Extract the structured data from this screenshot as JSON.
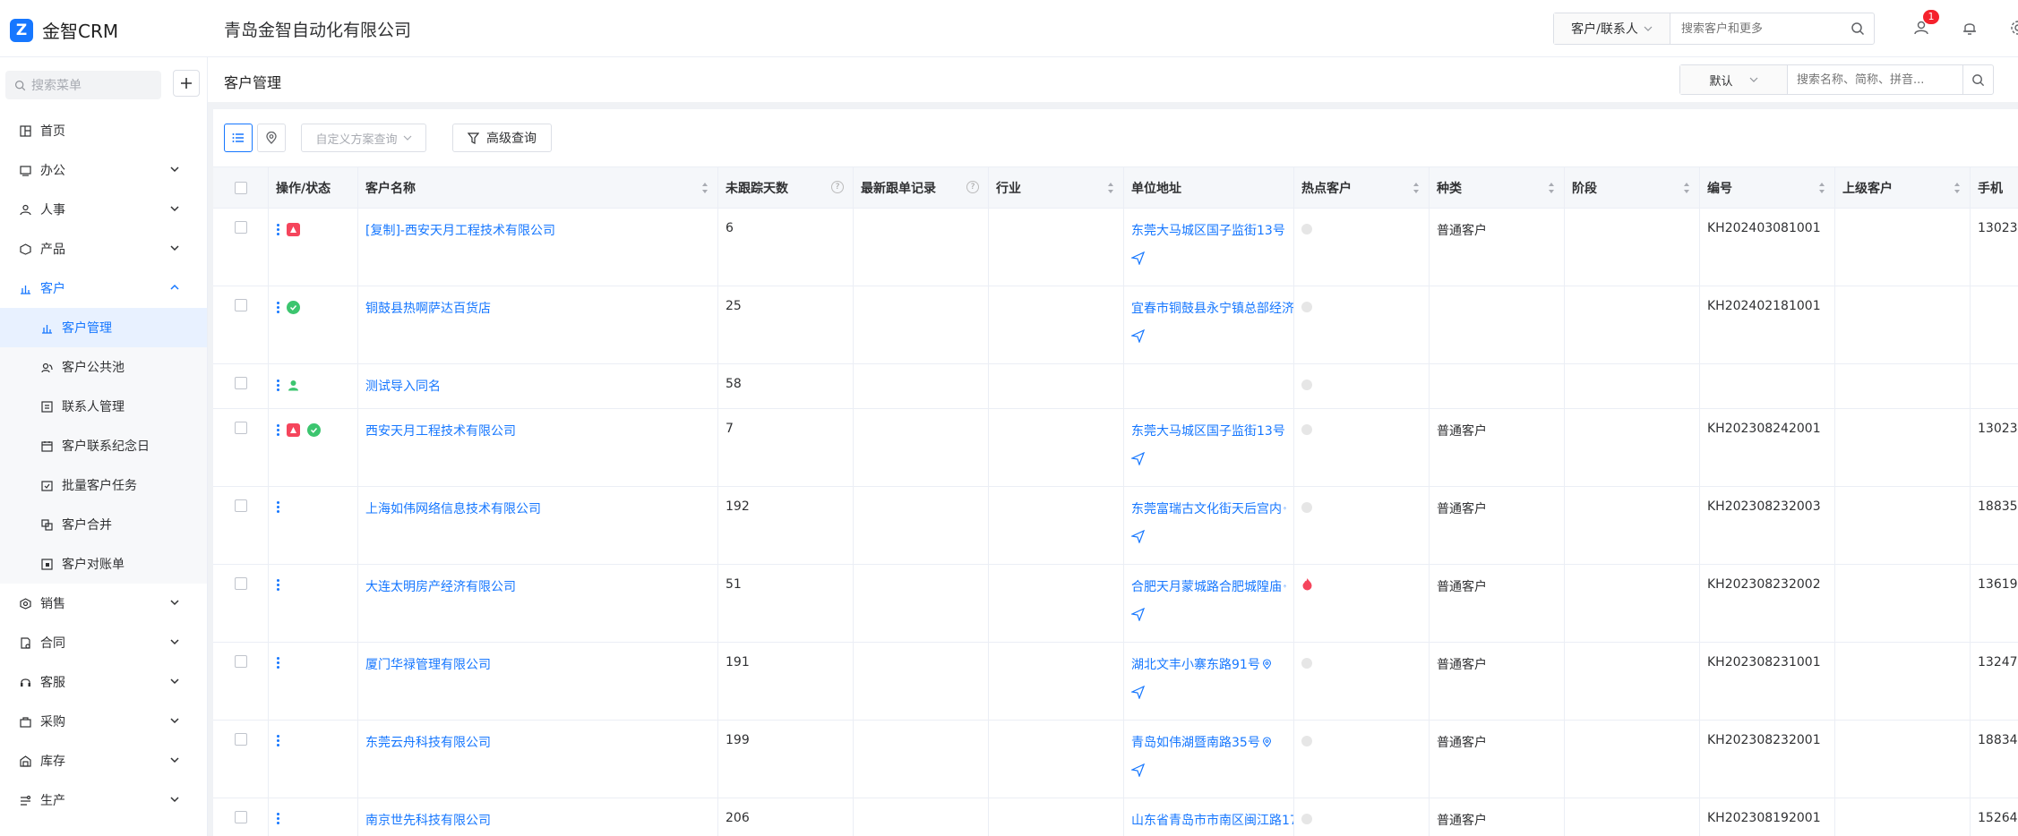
{
  "app": {
    "name": "金智CRM",
    "company": "青岛金智自动化有限公司"
  },
  "header_search": {
    "type_label": "客户/联系人",
    "placeholder": "搜索客户和更多",
    "notification_count": "1"
  },
  "sidebar": {
    "search_placeholder": "搜索菜单",
    "items": [
      {
        "label": "首页",
        "icon": "home-icon"
      },
      {
        "label": "办公",
        "icon": "office-icon"
      },
      {
        "label": "人事",
        "icon": "people-icon"
      },
      {
        "label": "产品",
        "icon": "product-icon"
      },
      {
        "label": "客户",
        "icon": "customer-icon"
      }
    ],
    "customer_sub": [
      {
        "label": "客户管理"
      },
      {
        "label": "客户公共池"
      },
      {
        "label": "联系人管理"
      },
      {
        "label": "客户联系纪念日"
      },
      {
        "label": "批量客户任务"
      },
      {
        "label": "客户合并"
      },
      {
        "label": "客户对账单"
      }
    ],
    "items_after": [
      {
        "label": "销售"
      },
      {
        "label": "合同"
      },
      {
        "label": "客服"
      },
      {
        "label": "采购"
      },
      {
        "label": "库存"
      },
      {
        "label": "生产"
      }
    ]
  },
  "page": {
    "title": "客户管理",
    "filter_select": "默认",
    "filter_placeholder": "搜索名称、简称、拼音...",
    "plan_placeholder": "自定义方案查询",
    "advanced_label": "高级查询"
  },
  "table": {
    "columns": [
      "操作/状态",
      "客户名称",
      "未跟踪天数",
      "最新跟单记录",
      "行业",
      "单位地址",
      "热点客户",
      "种类",
      "阶段",
      "编号",
      "上级客户",
      "手机"
    ],
    "rows": [
      {
        "name": "[复制]-西安天月工程技术有限公司",
        "days": "6",
        "address": "东莞大马城区国子监街13号",
        "hot": false,
        "kind": "普通客户",
        "code": "KH202403081001",
        "phone": "13023",
        "status": [
          "red"
        ]
      },
      {
        "name": "铜鼓县热啊萨达百货店",
        "days": "25",
        "address": "宜春市铜鼓县永宁镇总部经济",
        "hot": false,
        "kind": "",
        "code": "KH202402181001",
        "phone": "",
        "status": [
          "green"
        ]
      },
      {
        "name": "测试导入同名",
        "days": "58",
        "address": "",
        "hot": false,
        "kind": "",
        "code": "",
        "phone": "",
        "status": [
          "person"
        ]
      },
      {
        "name": "西安天月工程技术有限公司",
        "days": "7",
        "address": "东莞大马城区国子监街13号",
        "hot": false,
        "kind": "普通客户",
        "code": "KH202308242001",
        "phone": "13023",
        "status": [
          "red",
          "green"
        ]
      },
      {
        "name": "上海如伟网络信息技术有限公司",
        "days": "192",
        "address": "东莞富瑞古文化街天后宫内",
        "hot": false,
        "kind": "普通客户",
        "code": "KH202308232003",
        "phone": "18835",
        "status": []
      },
      {
        "name": "大连太明房产经济有限公司",
        "days": "51",
        "address": "合肥天月蒙城路合肥城隍庙",
        "hot": true,
        "kind": "普通客户",
        "code": "KH202308232002",
        "phone": "13619",
        "status": []
      },
      {
        "name": "厦门华禄管理有限公司",
        "days": "191",
        "address": "湖北文丰小寨东路91号",
        "hot": false,
        "kind": "普通客户",
        "code": "KH202308231001",
        "phone": "13247",
        "status": []
      },
      {
        "name": "东莞云舟科技有限公司",
        "days": "199",
        "address": "青岛如伟湖暨南路35号",
        "hot": false,
        "kind": "普通客户",
        "code": "KH202308232001",
        "phone": "18834",
        "status": []
      },
      {
        "name": "南京世先科技有限公司",
        "days": "206",
        "address": "山东省青岛市市南区闽江路17",
        "hot": false,
        "kind": "普通客户",
        "code": "KH202308192001",
        "phone": "15264",
        "status": []
      }
    ]
  },
  "colors": {
    "accent": "#1677ff",
    "status_red": "#f5455c",
    "status_green": "#3cc56f"
  }
}
